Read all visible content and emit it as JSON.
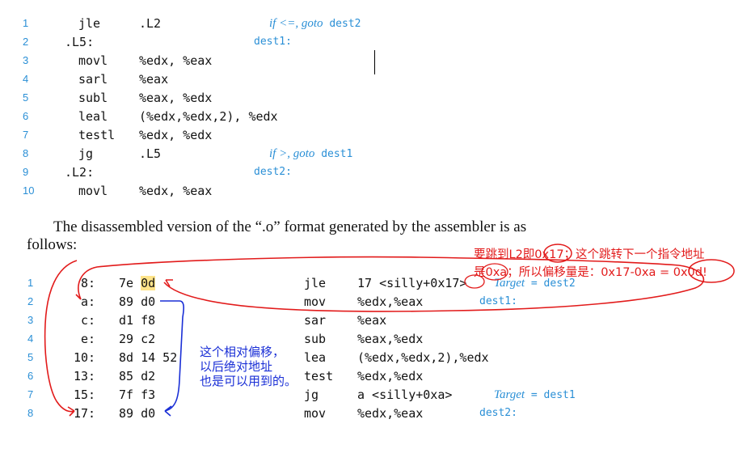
{
  "asm_listing": [
    {
      "n": "1",
      "label": "",
      "op": "jle",
      "args": ".L2",
      "comment_italic": "if <=, goto",
      "comment_target": "dest2"
    },
    {
      "n": "2",
      "label": ".L5:",
      "op": "",
      "args": "",
      "comment_italic": "",
      "comment_target": "dest1:"
    },
    {
      "n": "3",
      "label": "",
      "op": "movl",
      "args": "%edx, %eax",
      "comment_italic": "",
      "comment_target": ""
    },
    {
      "n": "4",
      "label": "",
      "op": "sarl",
      "args": "%eax",
      "comment_italic": "",
      "comment_target": ""
    },
    {
      "n": "5",
      "label": "",
      "op": "subl",
      "args": "%eax, %edx",
      "comment_italic": "",
      "comment_target": ""
    },
    {
      "n": "6",
      "label": "",
      "op": "leal",
      "args": "(%edx,%edx,2), %edx",
      "comment_italic": "",
      "comment_target": ""
    },
    {
      "n": "7",
      "label": "",
      "op": "testl",
      "args": "%edx, %edx",
      "comment_italic": "",
      "comment_target": ""
    },
    {
      "n": "8",
      "label": "",
      "op": "jg",
      "args": ".L5",
      "comment_italic": "if >, goto",
      "comment_target": "dest1"
    },
    {
      "n": "9",
      "label": ".L2:",
      "op": "",
      "args": "",
      "comment_italic": "",
      "comment_target": "dest2:"
    },
    {
      "n": "10",
      "label": "",
      "op": "movl",
      "args": "%edx, %eax",
      "comment_italic": "",
      "comment_target": ""
    }
  ],
  "prose_line1": "The disassembled version of the “.o” format generated by the assembler is as",
  "prose_line2": "follows:",
  "disasm_listing": [
    {
      "n": "1",
      "addr": "8:",
      "b1": "7e",
      "b2": "0d",
      "op": "jle",
      "args": "17 <silly+0x17>",
      "comment_italic": "Target",
      "comment_target": "= dest2"
    },
    {
      "n": "2",
      "addr": "a:",
      "b1": "89 d0",
      "b2": "",
      "op": "mov",
      "args": "%edx,%eax",
      "comment_italic": "",
      "comment_target": "dest1:"
    },
    {
      "n": "3",
      "addr": "c:",
      "b1": "d1 f8",
      "b2": "",
      "op": "sar",
      "args": "%eax",
      "comment_italic": "",
      "comment_target": ""
    },
    {
      "n": "4",
      "addr": "e:",
      "b1": "29 c2",
      "b2": "",
      "op": "sub",
      "args": "%eax,%edx",
      "comment_italic": "",
      "comment_target": ""
    },
    {
      "n": "5",
      "addr": "10:",
      "b1": "8d 14 52",
      "b2": "",
      "op": "lea",
      "args": "(%edx,%edx,2),%edx",
      "comment_italic": "",
      "comment_target": ""
    },
    {
      "n": "6",
      "addr": "13:",
      "b1": "85 d2",
      "b2": "",
      "op": "test",
      "args": "%edx,%edx",
      "comment_italic": "",
      "comment_target": ""
    },
    {
      "n": "7",
      "addr": "15:",
      "b1": "7f f3",
      "b2": "",
      "op": "jg",
      "args": "a <silly+0xa>",
      "comment_italic": "Target",
      "comment_target": "= dest1"
    },
    {
      "n": "8",
      "addr": "17:",
      "b1": "89 d0",
      "b2": "",
      "op": "mov",
      "args": "%edx,%eax",
      "comment_italic": "",
      "comment_target": "dest2:"
    }
  ],
  "annotations": {
    "red_line1": "要跳到L2即0x17；这个跳转下一个指令地址",
    "red_line2": "是0xa；所以偏移量是：0x17-0xa = 0x0d!",
    "blue_line1": "这个相对偏移，",
    "blue_line2": "以后绝对地址",
    "blue_line3": "也是可以用到的。"
  },
  "colors": {
    "red": "#e21b1b",
    "blue": "#1a2fd6",
    "comment": "#2a8fd6",
    "highlight": "#ffe48a"
  }
}
